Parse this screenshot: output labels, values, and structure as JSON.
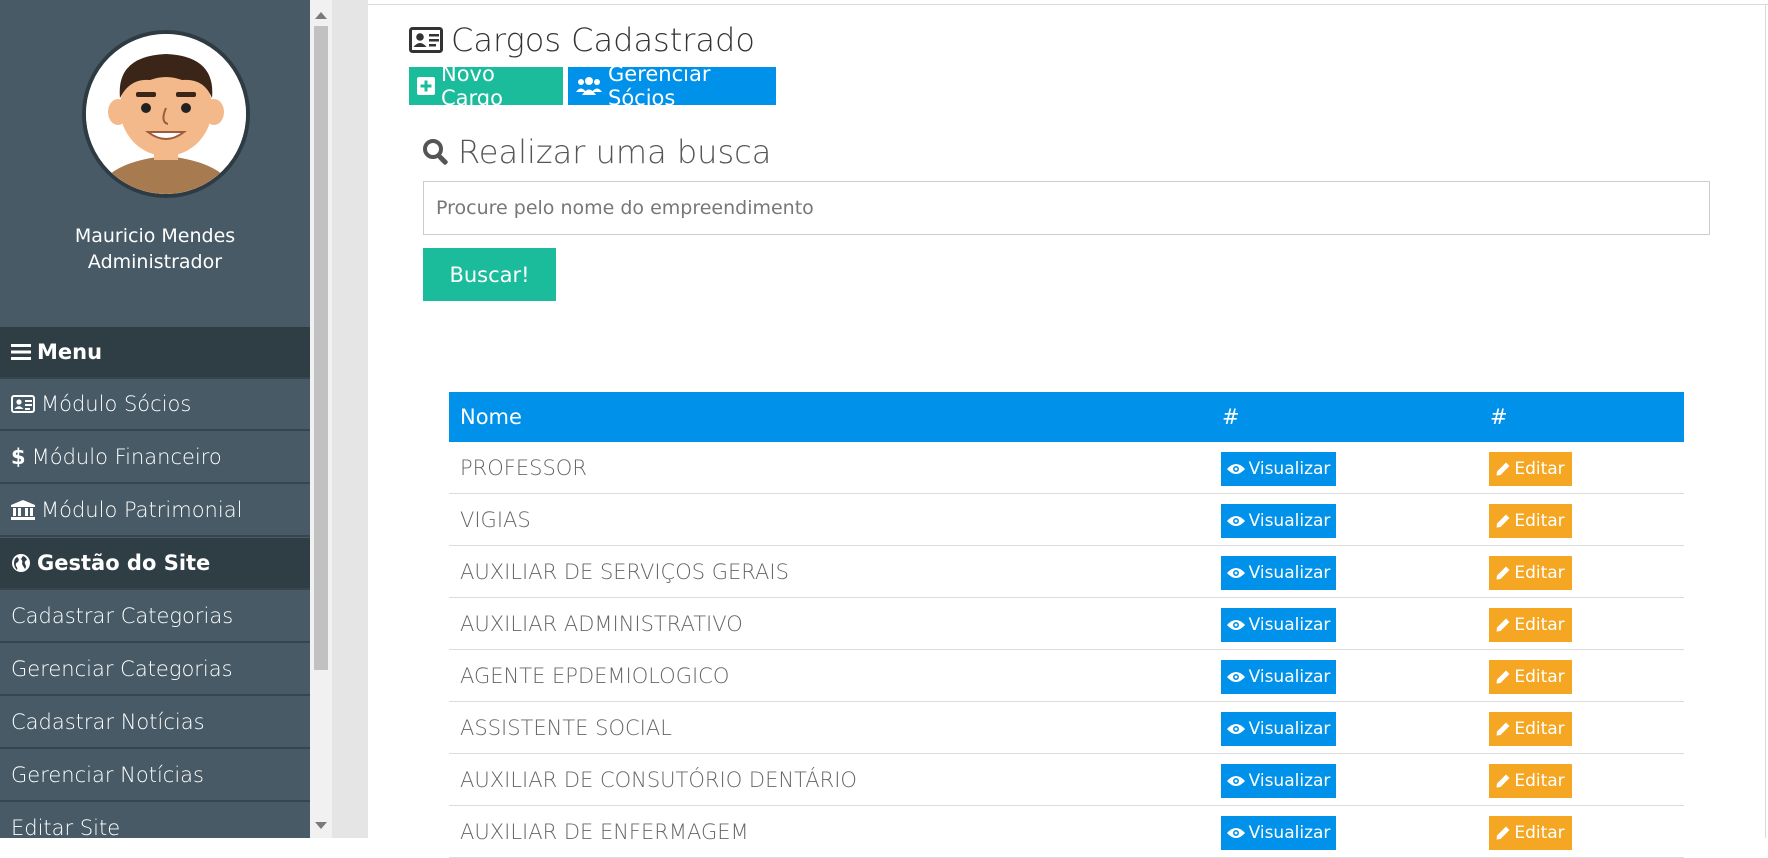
{
  "user": {
    "name": "Mauricio Mendes",
    "role": "Administrador"
  },
  "sidebar": {
    "items": [
      {
        "label": "Menu",
        "icon": "bars-icon",
        "header": true
      },
      {
        "label": "Módulo Sócios",
        "icon": "id-card-icon"
      },
      {
        "label": "Módulo Financeiro",
        "icon": "dollar-icon"
      },
      {
        "label": "Módulo Patrimonial",
        "icon": "bank-icon"
      },
      {
        "label": "Gestão do Site",
        "icon": "globe-icon",
        "header": true
      },
      {
        "label": "Cadastrar Categorias"
      },
      {
        "label": "Gerenciar Categorias"
      },
      {
        "label": "Cadastrar Notícias"
      },
      {
        "label": "Gerenciar Notícias"
      },
      {
        "label": "Editar Site"
      }
    ]
  },
  "page": {
    "title": "Cargos Cadastrado",
    "new_button": "Novo Cargo",
    "manage_button": "Gerenciar Sócios"
  },
  "search": {
    "title": "Realizar uma busca",
    "placeholder": "Procure pelo nome do empreendimento",
    "button": "Buscar!"
  },
  "table": {
    "headers": [
      "Nome",
      "#",
      "#"
    ],
    "view_label": "Visualizar",
    "edit_label": "Editar",
    "rows": [
      "PROFESSOR",
      "VIGIAS",
      "AUXILIAR DE SERVIÇOS GERAIS",
      "AUXILIAR ADMINISTRATIVO",
      "AGENTE EPDEMIOLOGICO",
      "ASSISTENTE SOCIAL",
      "AUXILIAR DE CONSUTÓRIO DENTÁRIO",
      "AUXILIAR DE ENFERMAGEM"
    ]
  },
  "colors": {
    "sidebar_bg": "#475a65",
    "sidebar_header_bg": "#2f3d45",
    "primary": "#0091ea",
    "success": "#1abc9c",
    "warning": "#f5a623"
  }
}
